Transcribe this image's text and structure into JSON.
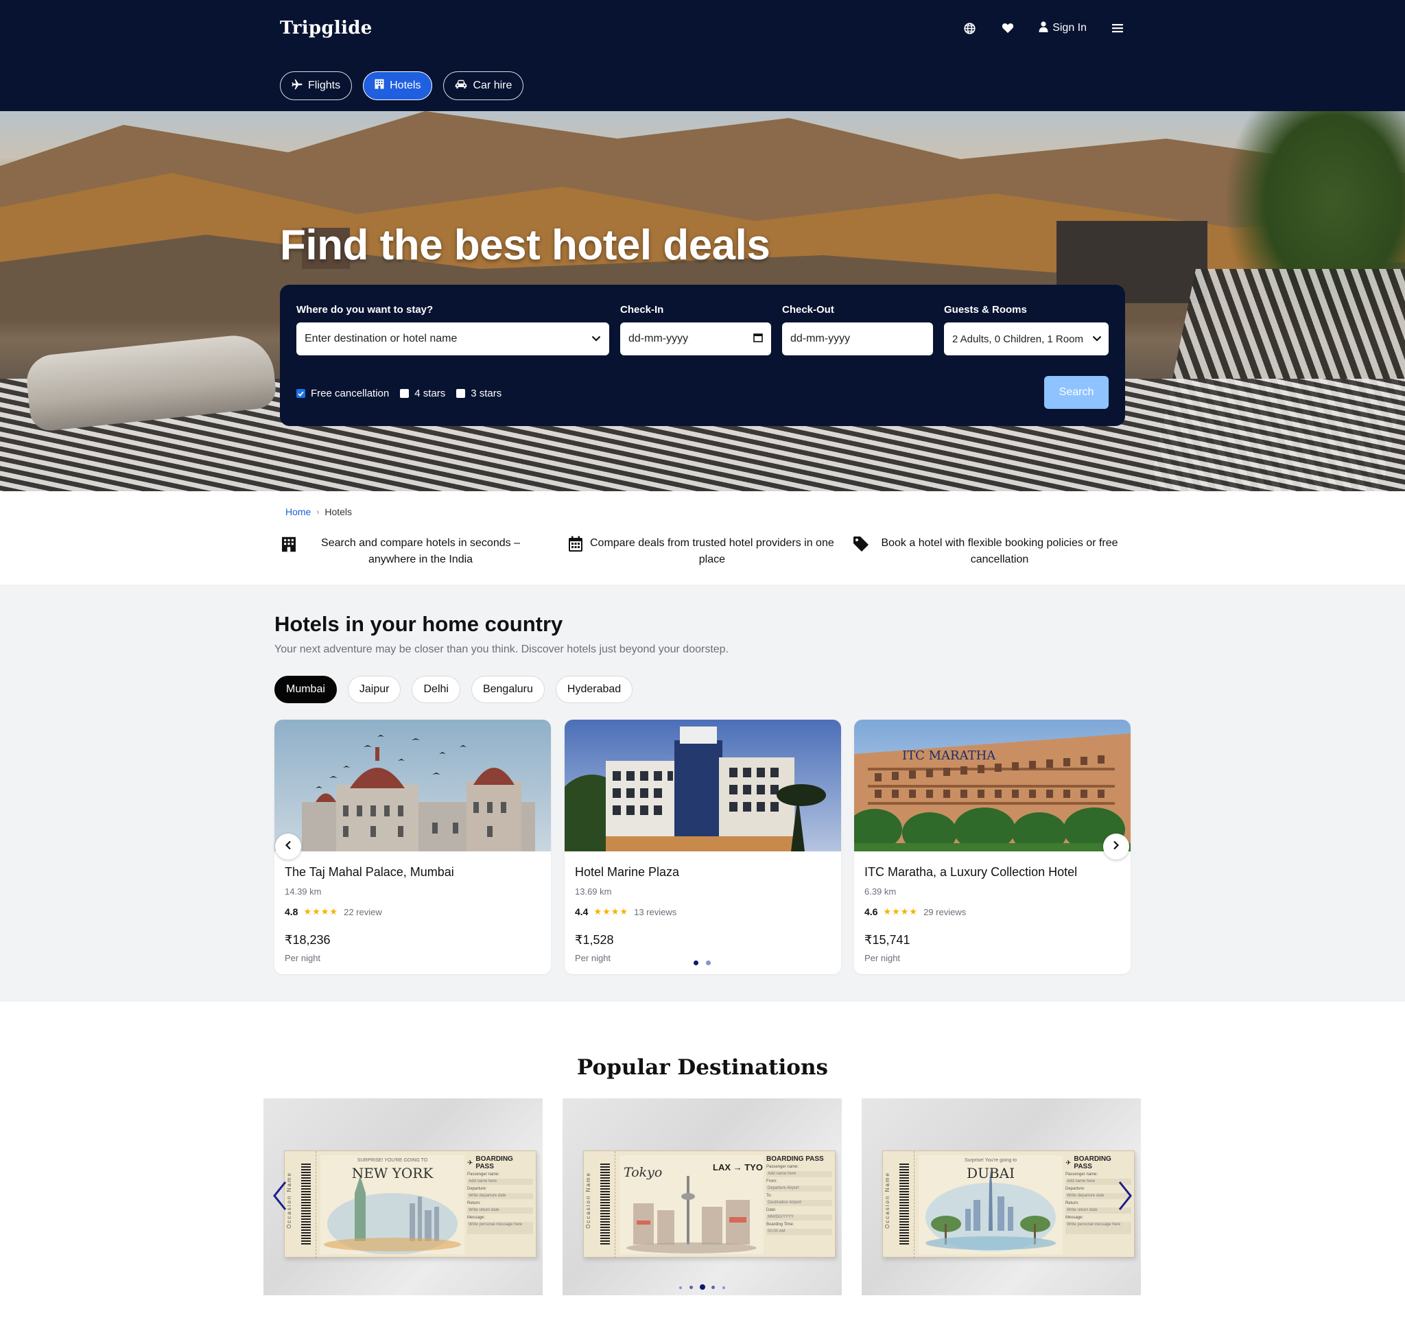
{
  "header": {
    "brand": "Tripglide",
    "sign_in": "Sign In",
    "icons": [
      "globe-icon",
      "heart-icon",
      "user-icon",
      "menu-icon"
    ]
  },
  "tabs": [
    {
      "label": "Flights",
      "icon": "plane-icon",
      "active": false
    },
    {
      "label": "Hotels",
      "icon": "hotel-icon",
      "active": true
    },
    {
      "label": "Car hire",
      "icon": "car-icon",
      "active": false
    }
  ],
  "hero": {
    "title": "Find the best hotel deals"
  },
  "search": {
    "destination_label": "Where do you want to stay?",
    "destination_placeholder": "Enter destination or hotel name",
    "checkin_label": "Check-In",
    "checkin_placeholder": "dd-mm-yyyy",
    "checkout_label": "Check-Out",
    "checkout_placeholder": "dd-mm-yyyy",
    "guests_label": "Guests & Rooms",
    "guests_value": "2 Adults, 0 Children, 1 Room",
    "filters": [
      {
        "label": "Free cancellation",
        "checked": true
      },
      {
        "label": "4 stars",
        "checked": false
      },
      {
        "label": "3 stars",
        "checked": false
      }
    ],
    "button": "Search",
    "button_color": "#8ec3ff"
  },
  "breadcrumb": [
    "Home",
    "Hotels"
  ],
  "features": [
    {
      "icon": "hotel-icon",
      "text": "Search and compare hotels in seconds – anywhere in the India"
    },
    {
      "icon": "calendar-icon",
      "text": "Compare deals from trusted hotel providers in one place"
    },
    {
      "icon": "tag-icon",
      "text": "Book a hotel with flexible booking policies or free cancellation"
    }
  ],
  "home_country": {
    "title": "Hotels in your home country",
    "subtitle": "Your next adventure may be closer than you think. Discover hotels just beyond your doorstep.",
    "cities": [
      {
        "label": "Mumbai",
        "active": true
      },
      {
        "label": "Jaipur",
        "active": false
      },
      {
        "label": "Delhi",
        "active": false
      },
      {
        "label": "Bengaluru",
        "active": false
      },
      {
        "label": "Hyderabad",
        "active": false
      }
    ],
    "hotels": [
      {
        "name": "The Taj Mahal Palace, Mumbai",
        "distance": "14.39 km",
        "score": "4.8",
        "stars": "★★★★",
        "reviews": "22 review",
        "price": "₹18,236",
        "per": "Per night"
      },
      {
        "name": "Hotel Marine Plaza",
        "distance": "13.69 km",
        "score": "4.4",
        "stars": "★★★★",
        "reviews": "13 reviews",
        "price": "₹1,528",
        "per": "Per night"
      },
      {
        "name": "ITC Maratha, a Luxury Collection Hotel",
        "distance": "6.39 km",
        "score": "4.6",
        "stars": "★★★★",
        "reviews": "29 reviews",
        "price": "₹15,741",
        "per": "Per night"
      }
    ],
    "pagination": {
      "pages": 2,
      "active": 1
    }
  },
  "popular": {
    "title": "Popular Destinations",
    "tickets": [
      {
        "surprise": "SURPRISE! YOU'RE GOING TO",
        "city": "NEW YORK",
        "pass": "BOARDING PASS",
        "occasion": "Occasion Name",
        "fields": [
          "Passenger name:",
          "Add name here",
          "Departure:",
          "Write departure date",
          "Return:",
          "Write return date",
          "Message:",
          "Write personal message here"
        ]
      },
      {
        "surprise": "",
        "city": "Tokyo",
        "route": "LAX → TYO",
        "pass": "BOARDING PASS",
        "occasion": "Occasion Name",
        "fields": [
          "Passenger name:",
          "Add name here",
          "From:",
          "Departure Airport",
          "To:",
          "Destination Airport",
          "Date:",
          "MM/DD/YYYY",
          "Boarding Time:",
          "00:00 AM"
        ]
      },
      {
        "surprise": "Surprise! You're going to",
        "city": "DUBAI",
        "pass": "BOARDING PASS",
        "occasion": "Occasion Name",
        "fields": [
          "Passenger name:",
          "Add name here",
          "Departure:",
          "Write departure date",
          "Return:",
          "Write return date",
          "Message:",
          "Write personal message here"
        ]
      }
    ],
    "pagination": {
      "pages": 5,
      "active": 3
    }
  },
  "colors": {
    "navy": "#081331",
    "accent": "#1f5fe0",
    "star": "#f5b301",
    "dot_active": "#0b1a6b",
    "dot_inactive": "#8a93c7"
  }
}
